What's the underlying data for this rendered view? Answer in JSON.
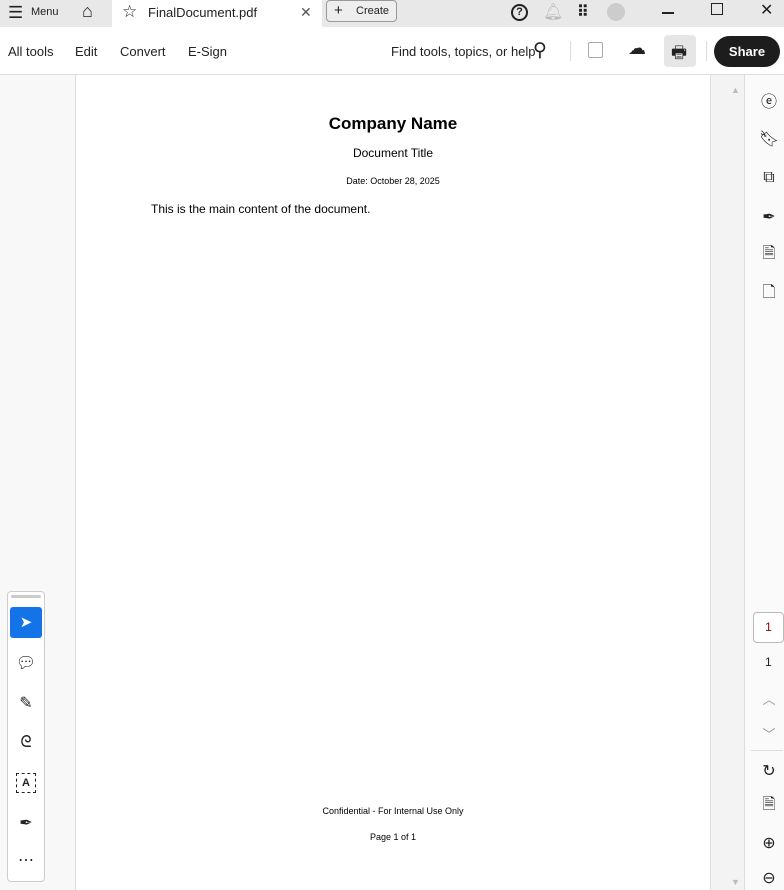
{
  "tabbar": {
    "menu_label": "Menu",
    "tab_title": "FinalDocument.pdf",
    "create_label": "Create"
  },
  "toolbar": {
    "items": [
      "All tools",
      "Edit",
      "Convert",
      "E-Sign"
    ],
    "search_label": "Find tools, topics, or help",
    "share_label": "Share"
  },
  "document": {
    "company": "Company Name",
    "title": "Document Title",
    "date": "Date: October 28, 2025",
    "body": "This is the main content of the document.",
    "footer": "Confidential - For Internal Use Only",
    "page_label": "Page 1 of 1"
  },
  "pagenav": {
    "current": "1",
    "total": "1"
  },
  "colors": {
    "accent": "#1473e6",
    "share_bg": "#1d1d1d"
  }
}
